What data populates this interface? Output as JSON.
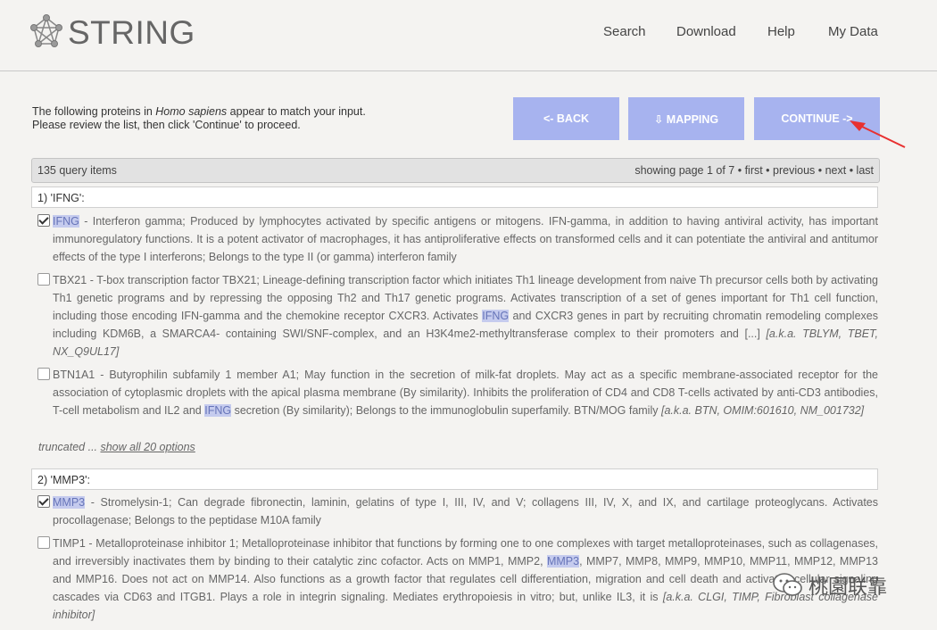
{
  "header": {
    "logo_text": "STRING",
    "nav": [
      "Search",
      "Download",
      "Help",
      "My Data"
    ]
  },
  "intro": {
    "line1_pre": "The following proteins in ",
    "line1_species": "Homo sapiens",
    "line1_post": " appear to match your input.",
    "line2": "Please review the list, then click 'Continue' to proceed."
  },
  "buttons": {
    "back": "<- BACK",
    "mapping": "⇩ MAPPING",
    "continue": "CONTINUE ->"
  },
  "pager": {
    "query_count": "135 query items",
    "status": "showing page 1 of 7 • first • previous • next • last"
  },
  "queries": [
    {
      "label": "1) 'IFNG':",
      "options": [
        {
          "checked": true,
          "pre": "",
          "hl": "IFNG",
          "text": " - Interferon gamma; Produced by lymphocytes activated by specific antigens or mitogens. IFN-gamma, in addition to having antiviral activity, has important immunoregulatory functions. It is a potent activator of macrophages, it has antiproliferative effects on transformed cells and it can potentiate the antiviral and antitumor effects of the type I interferons; Belongs to the type II (or gamma) interferon family",
          "post": "",
          "aka": ""
        },
        {
          "checked": false,
          "pre": "TBX21 - T-box transcription factor TBX21; Lineage-defining transcription factor which initiates Th1 lineage development from naive Th precursor cells both by activating Th1 genetic programs and by repressing the opposing Th2 and Th17 genetic programs. Activates transcription of a set of genes important for Th1 cell function, including those encoding IFN-gamma and the chemokine receptor CXCR3. Activates ",
          "hl": "IFNG",
          "text": " and CXCR3 genes in part by recruiting chromatin remodeling complexes including KDM6B, a SMARCA4- containing SWI/SNF-complex, and an H3K4me2-methyltransferase complex to their promoters and [...] ",
          "post": "",
          "aka": "[a.k.a. TBLYM, TBET, NX_Q9UL17]"
        },
        {
          "checked": false,
          "pre": "BTN1A1 - Butyrophilin subfamily 1 member A1; May function in the secretion of milk-fat droplets. May act as a specific membrane-associated receptor for the association of cytoplasmic droplets with the apical plasma membrane (By similarity). Inhibits the proliferation of CD4 and CD8 T-cells activated by anti-CD3 antibodies, T-cell metabolism and IL2 and ",
          "hl": "IFNG",
          "text": " secretion (By similarity); Belongs to the immunoglobulin superfamily. BTN/MOG family ",
          "post": "",
          "aka": "[a.k.a. BTN, OMIM:601610, NM_001732]"
        }
      ],
      "truncated": "truncated ... ",
      "show_all": "show all 20 options"
    },
    {
      "label": "2) 'MMP3':",
      "options": [
        {
          "checked": true,
          "pre": "",
          "hl": "MMP3",
          "text": " - Stromelysin-1; Can degrade fibronectin, laminin, gelatins of type I, III, IV, and V; collagens III, IV, X, and IX, and cartilage proteoglycans. Activates procollagenase; Belongs to the peptidase M10A family",
          "post": "",
          "aka": ""
        },
        {
          "checked": false,
          "pre": "TIMP1 - Metalloproteinase inhibitor 1; Metalloproteinase inhibitor that functions by forming one to one complexes with target metalloproteinases, such as collagenases, and irreversibly inactivates them by binding to their catalytic zinc cofactor. Acts on MMP1, MMP2, ",
          "hl": "MMP3",
          "text": ", MMP7, MMP8, MMP9, MMP10, MMP11, MMP12, MMP13 and MMP16. Does not act on MMP14. Also functions as a growth factor that regulates cell differentiation, migration and cell death and activates cellular signaling cascades via CD63 and ITGB1. Plays a role in integrin signaling. Mediates erythropoiesis in vitro; but, unlike IL3, it is ",
          "post": "",
          "aka": "[a.k.a. CLGI, TIMP, Fibroblast collagenase inhibitor]"
        }
      ]
    }
  ],
  "watermark": "桃園联靠"
}
